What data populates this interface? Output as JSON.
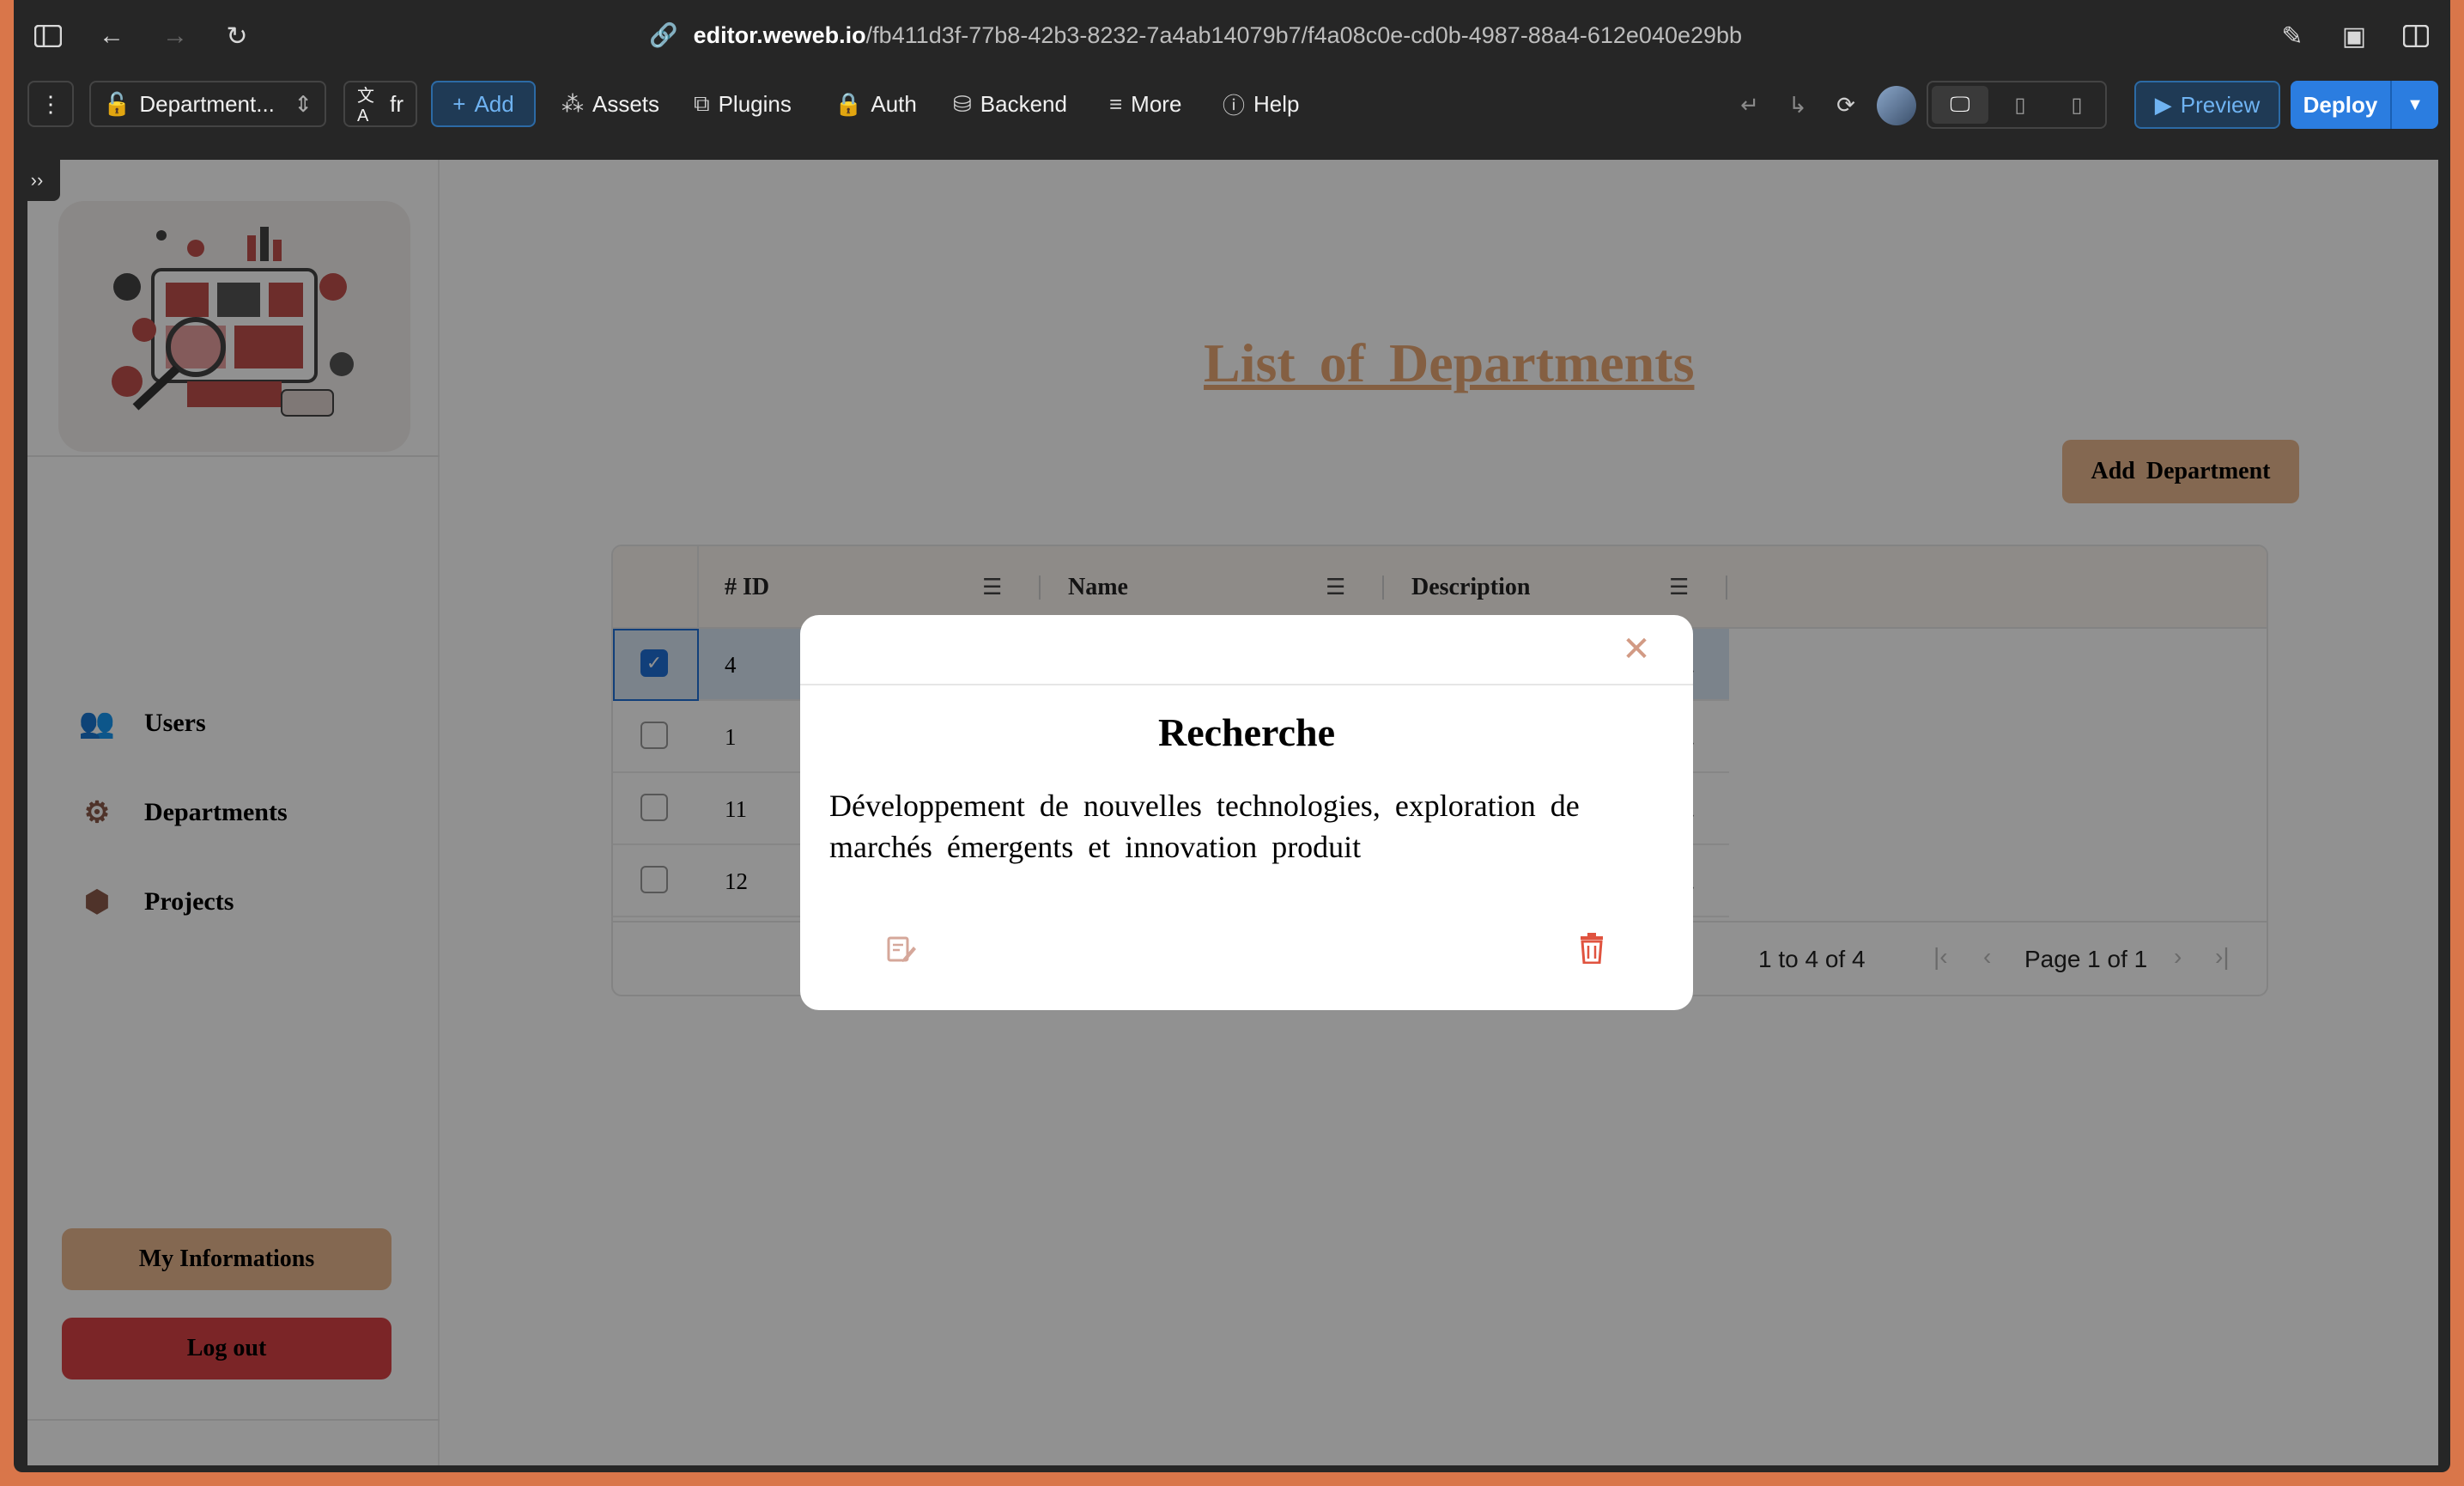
{
  "browser": {
    "url_host": "editor.weweb.io",
    "url_path": "/fb411d3f-77b8-42b3-8232-7a4ab14079b7/f4a08c0e-cd0b-4987-88a4-612e040e29bb"
  },
  "toolbar": {
    "page_selector": "Department...",
    "language": "fr",
    "add_label": "Add",
    "assets_label": "Assets",
    "plugins_label": "Plugins",
    "auth_label": "Auth",
    "backend_label": "Backend",
    "more_label": "More",
    "help_label": "Help",
    "preview_label": "Preview",
    "deploy_label": "Deploy"
  },
  "sidebar": {
    "items": [
      {
        "label": "Users",
        "icon": "users-icon"
      },
      {
        "label": "Departments",
        "icon": "gears-icon"
      },
      {
        "label": "Projects",
        "icon": "boxes-icon"
      }
    ],
    "my_info_label": "My  Informations",
    "logout_label": "Log  out"
  },
  "main": {
    "title": "List of Departments",
    "add_button": "Add  Department"
  },
  "table": {
    "columns": [
      "# ID",
      "Name",
      "Description"
    ],
    "rows": [
      {
        "id": "4",
        "selected": true,
        "desc_tail": "..."
      },
      {
        "id": "1",
        "selected": false,
        "desc_tail": "..."
      },
      {
        "id": "11",
        "selected": false,
        "desc_tail": "..."
      },
      {
        "id": "12",
        "selected": false,
        "desc_tail": "..."
      }
    ],
    "range_text": "1 to 4 of 4",
    "page_text": "Page 1 of 1"
  },
  "modal": {
    "title": "Recherche",
    "description": "Développement de nouvelles technologies, exploration de marchés émergents et innovation produit"
  },
  "colors": {
    "accent": "#e9b88f",
    "title": "#e8a774",
    "logout": "#d84246",
    "editor_blue": "#2b7de0"
  }
}
